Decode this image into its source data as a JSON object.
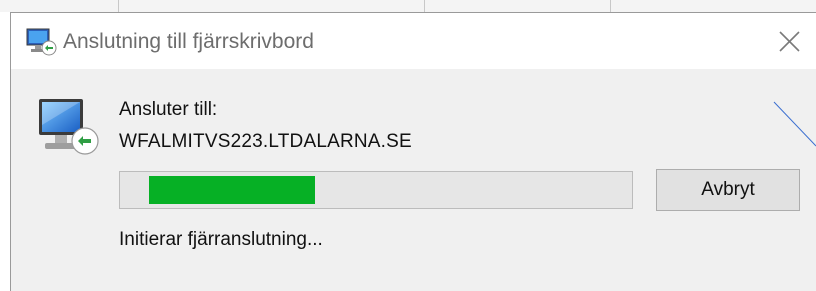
{
  "window": {
    "title": "Anslutning till fjärrskrivbord",
    "title_icon": "remote-desktop-icon",
    "close_icon": "close-icon"
  },
  "dialog": {
    "connecting_label": "Ansluter till:",
    "host": "WFALMITVS223.LTDALARNA.SE",
    "progress_fraction": 0.33,
    "cancel_label": "Avbryt",
    "status": "Initierar fjärranslutning...",
    "main_icon": "remote-desktop-monitor-icon"
  },
  "colors": {
    "progress": "#06b025",
    "title_text": "#6d6d6d",
    "content_bg": "#f0f0f0"
  }
}
